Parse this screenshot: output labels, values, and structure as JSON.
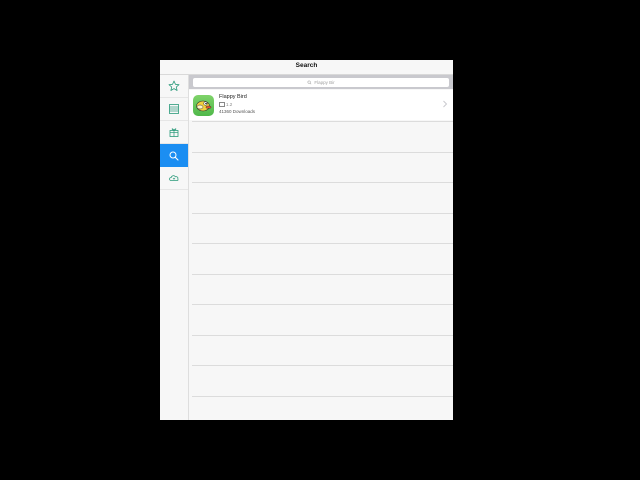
{
  "navbar": {
    "title": "Search"
  },
  "sidebar": {
    "tabs": [
      {
        "name": "favorites",
        "icon": "star-icon"
      },
      {
        "name": "list",
        "icon": "list-icon"
      },
      {
        "name": "gift",
        "icon": "gift-icon"
      },
      {
        "name": "search",
        "icon": "search-icon",
        "active": true
      },
      {
        "name": "cloud",
        "icon": "cloud-download-icon"
      }
    ]
  },
  "search": {
    "placeholder": "Flappy Bir"
  },
  "results": [
    {
      "name": "Flappy Bird",
      "version": "1.2",
      "downloads": "41360 Downloads"
    }
  ],
  "colors": {
    "accent": "#1b8ef2",
    "tab_icon": "#2a9a7a"
  }
}
